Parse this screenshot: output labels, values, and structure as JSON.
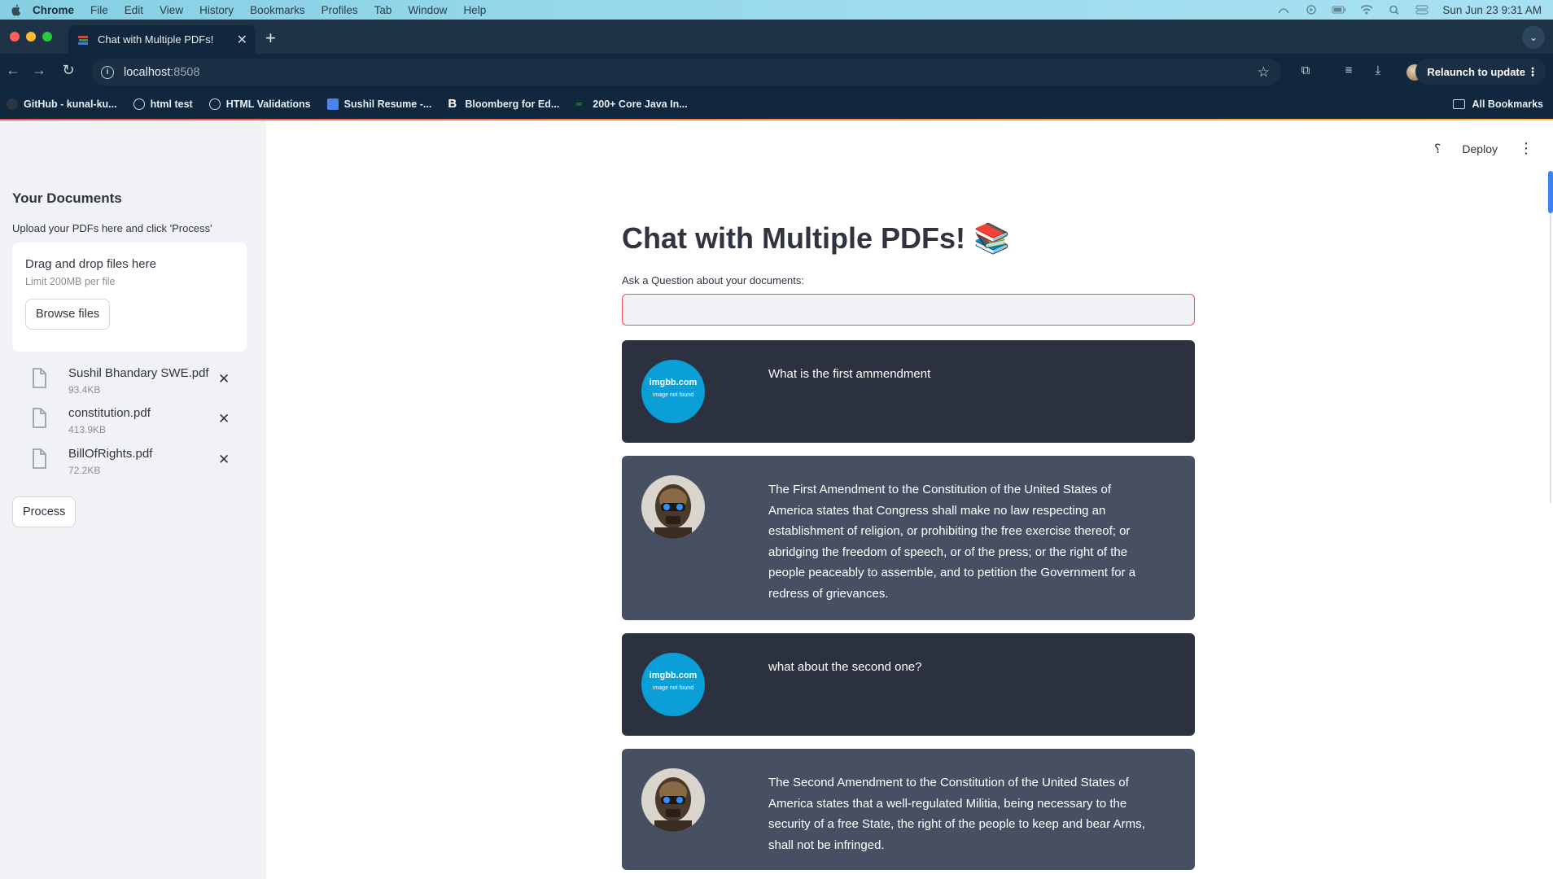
{
  "macos": {
    "app_name": "Chrome",
    "menus": [
      "File",
      "Edit",
      "View",
      "History",
      "Bookmarks",
      "Profiles",
      "Tab",
      "Window",
      "Help"
    ],
    "clock": "Sun Jun 23  9:31 AM"
  },
  "browser": {
    "tab_title": "Chat with Multiple PDFs!",
    "url_host": "localhost",
    "url_port": ":8508",
    "relaunch_label": "Relaunch to update",
    "bookmarks": [
      "GitHub - kunal-ku...",
      "html test",
      "HTML Validations",
      "Sushil Resume -...",
      "Bloomberg for Ed...",
      "200+ Core Java In..."
    ],
    "all_bookmarks": "All Bookmarks"
  },
  "sidebar": {
    "title": "Your Documents",
    "help": "Upload your PDFs here and click 'Process'",
    "dropzone_title": "Drag and drop files here",
    "dropzone_limit": "Limit 200MB per file",
    "browse_label": "Browse files",
    "files": [
      {
        "name": "Sushil Bhandary SWE.pdf",
        "size": "93.4KB"
      },
      {
        "name": "constitution.pdf",
        "size": "413.9KB"
      },
      {
        "name": "BillOfRights.pdf",
        "size": "72.2KB"
      }
    ],
    "process_label": "Process"
  },
  "header": {
    "deploy_label": "Deploy"
  },
  "main": {
    "title": "Chat with Multiple PDFs! 📚",
    "question_label": "Ask a Question about your documents:",
    "question_value": "",
    "avatar_user_line1": "imgbb.com",
    "avatar_user_line2": "image not found",
    "messages": [
      {
        "role": "user",
        "text": "What is the first ammendment"
      },
      {
        "role": "bot",
        "text": "The First Amendment to the Constitution of the United States of America states that Congress shall make no law respecting an establishment of religion, or prohibiting the free exercise thereof; or abridging the freedom of speech, or of the press; or the right of the people peaceably to assemble, and to petition the Government for a redress of grievances."
      },
      {
        "role": "user",
        "text": "what about the second one?"
      },
      {
        "role": "bot",
        "text": "The Second Amendment to the Constitution of the United States of America states that a well-regulated Militia, being necessary to the security of a free State, the right of the people to keep and bear Arms, shall not be infringed."
      }
    ]
  },
  "colors": {
    "accent": "#ff4b4b",
    "user_bubble": "#2b313e",
    "bot_bubble": "#475063",
    "sidebar_bg": "#f0f2f6"
  }
}
